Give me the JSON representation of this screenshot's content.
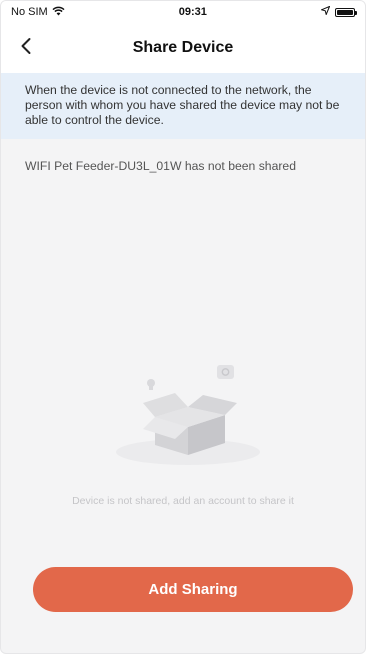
{
  "status_bar": {
    "carrier": "No SIM",
    "time": "09:31",
    "icons": [
      "wifi-icon",
      "location-arrow-icon",
      "battery-icon"
    ]
  },
  "nav": {
    "title": "Share Device",
    "back_icon": "chevron-left-icon"
  },
  "notice": {
    "text": "When the device is not connected to the network, the person with whom you have shared the device may not be able to control the device."
  },
  "share_status": {
    "text": "WIFI Pet Feeder-DU3L_01W has not been shared"
  },
  "empty_state": {
    "illustration": "open-box-icon",
    "text": "Device is not shared, add an account to share it"
  },
  "actions": {
    "add_sharing_label": "Add Sharing"
  },
  "colors": {
    "accent": "#e2684a",
    "notice_bg": "#e6eff9",
    "page_bg": "#f4f4f5"
  }
}
